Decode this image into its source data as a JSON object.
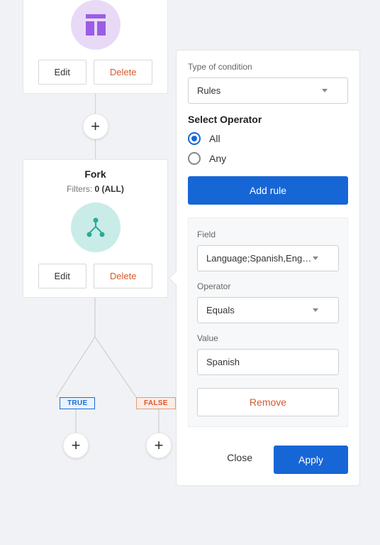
{
  "flow": {
    "card1": {
      "edit": "Edit",
      "delete": "Delete"
    },
    "card2": {
      "title": "Fork",
      "filters_label": "Filters: ",
      "filters_value": "0 (ALL)",
      "edit": "Edit",
      "delete": "Delete"
    },
    "branch": {
      "true": "TRUE",
      "false": "FALSE"
    }
  },
  "panel": {
    "type_label": "Type of condition",
    "type_value": "Rules",
    "operator_heading": "Select Operator",
    "radio_all": "All",
    "radio_any": "Any",
    "add_rule": "Add rule",
    "rule": {
      "field_label": "Field",
      "field_value": "Language;Spanish,English",
      "operator_label": "Operator",
      "operator_value": "Equals",
      "value_label": "Value",
      "value_value": "Spanish",
      "remove": "Remove"
    },
    "close": "Close",
    "apply": "Apply"
  }
}
